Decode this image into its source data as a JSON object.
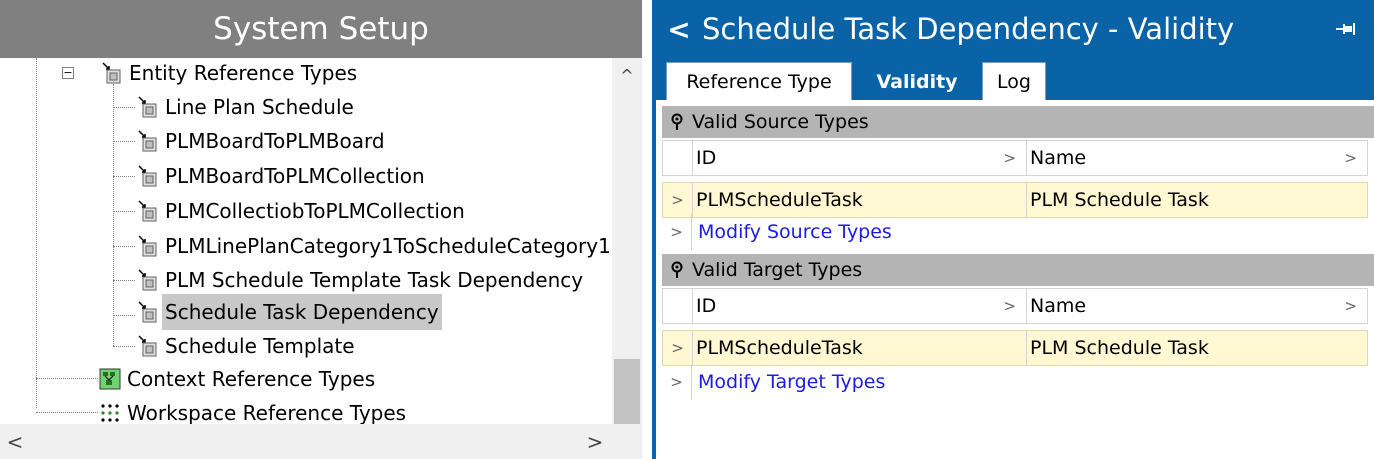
{
  "left_panel": {
    "title": "System Setup",
    "tree": {
      "root_label": "Entity Reference Types",
      "children": [
        "Line Plan Schedule",
        "PLMBoardToPLMBoard",
        "PLMBoardToPLMCollection",
        "PLMCollectiobToPLMCollection",
        "PLMLinePlanCategory1ToScheduleCategory1",
        "PLM Schedule Template Task Dependency",
        "Schedule Task Dependency",
        "Schedule Template"
      ],
      "selected_child": "Schedule Task Dependency",
      "siblings": [
        "Context Reference Types",
        "Workspace Reference Types"
      ]
    },
    "scroll": {
      "up_glyph": "^",
      "left_glyph": "<",
      "right_glyph": ">"
    }
  },
  "right_panel": {
    "title": "Schedule Task Dependency - Validity",
    "back_glyph": "<",
    "tabs": [
      {
        "label": "Reference Type",
        "active": false
      },
      {
        "label": "Validity",
        "active": true
      },
      {
        "label": "Log",
        "active": false
      }
    ],
    "sections": [
      {
        "title": "Valid Source Types",
        "columns": [
          "ID",
          "Name"
        ],
        "rows": [
          {
            "id": "PLMScheduleTask",
            "name": "PLM Schedule Task"
          }
        ],
        "action_link": "Modify Source Types"
      },
      {
        "title": "Valid Target Types",
        "columns": [
          "ID",
          "Name"
        ],
        "rows": [
          {
            "id": "PLMScheduleTask",
            "name": "PLM Schedule Task"
          }
        ],
        "action_link": "Modify Target Types"
      }
    ]
  },
  "colors": {
    "accent_blue": "#0a63a6",
    "left_header_gray": "#808080",
    "section_gray": "#b4b4b4",
    "row_highlight_yellow": "#fff8d2",
    "link_blue": "#1c1ce0",
    "selection_gray": "#c8c8c8"
  },
  "icons": {
    "tree_item": "entity-reference-icon",
    "context": "context-reference-icon",
    "workspace": "workspace-reference-icon",
    "pin": "pin-icon",
    "filter": "filter-pin-icon"
  }
}
